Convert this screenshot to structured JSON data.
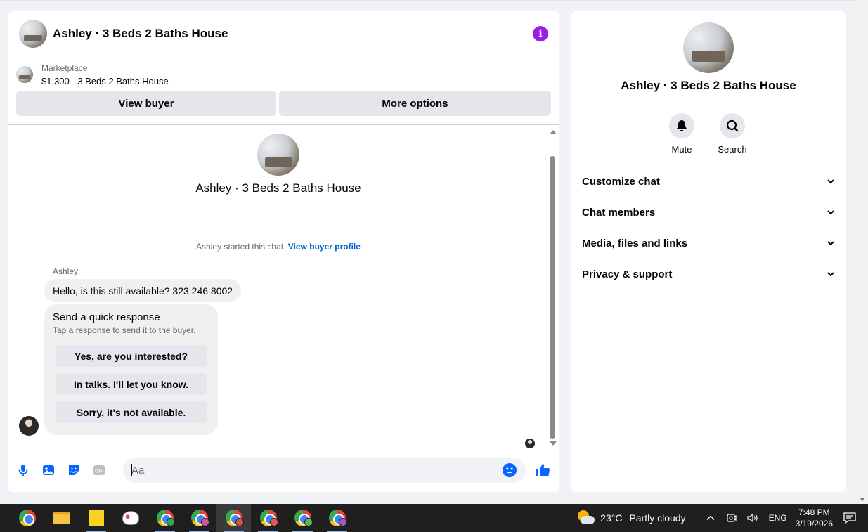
{
  "chat": {
    "title": "Ashley · 3 Beds 2 Baths House",
    "listing_source": "Marketplace",
    "listing_price_title": "$1,300 - 3 Beds 2 Baths House",
    "view_buyer_label": "View buyer",
    "more_options_label": "More options",
    "conversation_title": "Ashley · 3 Beds 2 Baths House",
    "started_text": "Ashley started this chat.",
    "view_profile_link": "View buyer profile",
    "sender_name": "Ashley",
    "message_text": "Hello, is this still available? 323 246 8002",
    "quick_title": "Send a quick response",
    "quick_subtitle": "Tap a response to send it to the buyer.",
    "quick_responses": [
      "Yes, are you interested?",
      "In talks. I'll let you know.",
      "Sorry, it's not available."
    ],
    "composer_placeholder": "Aa",
    "accent_color": "#0866ff",
    "info_color": "#9b1de8"
  },
  "info_panel": {
    "title": "Ashley · 3 Beds 2 Baths House",
    "mute_label": "Mute",
    "search_label": "Search",
    "sections": [
      "Customize chat",
      "Chat members",
      "Media, files and links",
      "Privacy & support"
    ]
  },
  "taskbar": {
    "weather_temp": "23°C",
    "weather_desc": "Partly cloudy",
    "language": "ENG",
    "time": "7:48 PM",
    "date": "3/19/2026"
  }
}
